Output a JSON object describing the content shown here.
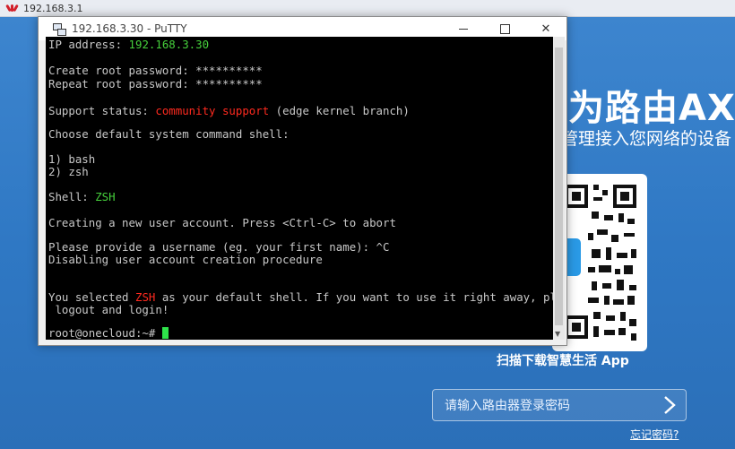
{
  "browser": {
    "tab_title": "192.168.3.1"
  },
  "router_page": {
    "hero_title": "为路由AX",
    "hero_subtitle": "管理接入您网络的设备",
    "qr_caption": "扫描下载智慧生活 App",
    "password_placeholder": "请输入路由器登录密码",
    "submit_icon": "chevron-right-icon",
    "forgot_link": "忘记密码?"
  },
  "putty": {
    "window_title": "192.168.3.30 - PuTTY",
    "controls": {
      "minimize": "minimize-icon",
      "maximize": "maximize-icon",
      "close": "✕"
    },
    "terminal": {
      "ip_label": "IP address: ",
      "ip_value": "192.168.3.30",
      "create_pw": "Create root password: **********",
      "repeat_pw": "Repeat root password: **********",
      "support_label": "Support status: ",
      "support_value": "community support",
      "support_suffix": " (edge kernel branch)",
      "choose_shell": "Choose default system command shell:",
      "option_1": "1) bash",
      "option_2": "2) zsh",
      "shell_label": "Shell: ",
      "shell_value": "ZSH",
      "create_user": "Creating a new user account. Press <Ctrl-C> to abort",
      "provide_username": "Please provide a username (eg. your first name): ^C",
      "disabling": "Disabling user account creation procedure",
      "selected_prefix": "You selected ",
      "selected_value": "ZSH",
      "selected_suffix": " as your default shell. If you want to use it right away, please",
      "relogin": " logout and login!",
      "prompt": "root@onecloud:~# "
    },
    "colors": {
      "green": "#46d13c",
      "red": "#ff2a1f",
      "text": "#c8c8c8",
      "background": "#000000"
    }
  }
}
